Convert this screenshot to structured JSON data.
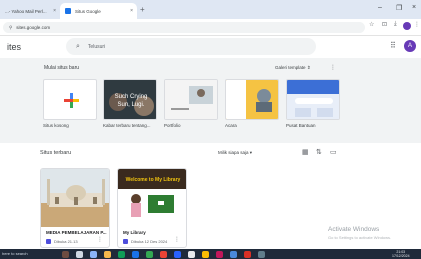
{
  "browser": {
    "tabs": [
      {
        "label": "...- Yahoo Mail Perl...",
        "active": false
      },
      {
        "label": "Situs Google",
        "active": true
      }
    ],
    "new_tab_label": "+",
    "url": "sites.google.com"
  },
  "app": {
    "title": "ites",
    "search_placeholder": "Telusuri",
    "avatar_letter": "A"
  },
  "templates": {
    "section_label": "Mulai situs baru",
    "gallery_label": "Galeri template",
    "items": [
      {
        "label": "Situs kosong"
      },
      {
        "label": "Kabar terbaru tentang..."
      },
      {
        "label": "Portfolio"
      },
      {
        "label": "Acara"
      },
      {
        "label": "Pusat Bantuan"
      }
    ],
    "thumb_text": "Such Crying\nSun, Lugi."
  },
  "recent": {
    "section_label": "Situs terbaru",
    "owner_filter": "Milik siapa saja",
    "sites": [
      {
        "title": "MEDIA PEMBELAJARAN P...",
        "meta": "Dibuka 21.13"
      },
      {
        "title": "My Library",
        "meta": "Dibuka 12 Des 2024",
        "banner": "Welcome to My Library"
      }
    ]
  },
  "watermark": {
    "line1": "Activate Windows",
    "line2": "Go to Settings to activate Windows."
  },
  "taskbar": {
    "search_text": "here to search",
    "time": "21:03",
    "date": "17/12/2024"
  },
  "colors": {
    "accent": "#1a73e8",
    "avatar": "#673ab7",
    "band": "#f1f3f4",
    "taskbar": "#1f2a3a"
  }
}
